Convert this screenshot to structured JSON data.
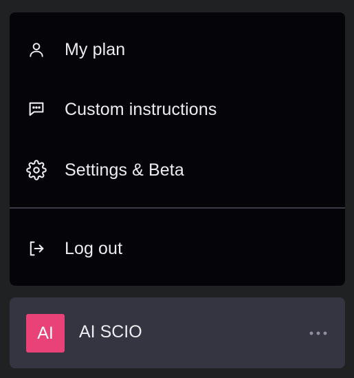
{
  "menu": {
    "items": [
      {
        "label": "My plan",
        "icon": "user-icon"
      },
      {
        "label": "Custom instructions",
        "icon": "message-dots-icon"
      },
      {
        "label": "Settings & Beta",
        "icon": "gear-icon"
      },
      {
        "label": "Log out",
        "icon": "logout-icon"
      }
    ]
  },
  "profile": {
    "avatar_initials": "AI",
    "name": "AI SCIO",
    "more_icon": "ellipsis-icon"
  },
  "colors": {
    "page_bg": "#202123",
    "menu_bg": "#050509",
    "profile_bg": "#343541",
    "avatar_bg": "#E84278",
    "text": "#ECECF1"
  }
}
